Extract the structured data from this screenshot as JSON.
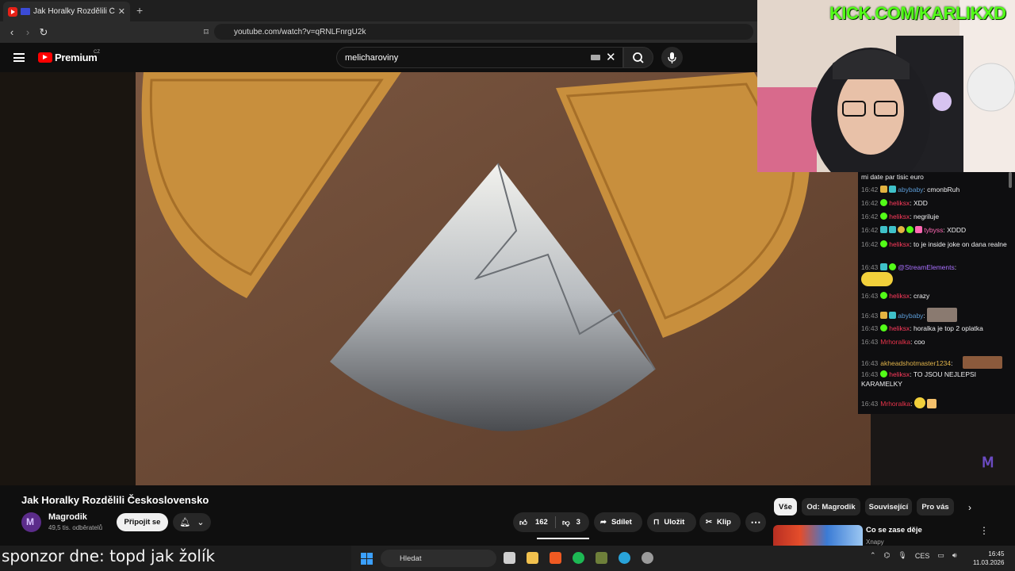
{
  "browser": {
    "tab_title": "Jak Horalky Rozdělili Českosl",
    "new_tab": "+",
    "url": "youtube.com/watch?v=qRNLFnrgU2k"
  },
  "youtube": {
    "logo_text": "Premium",
    "region": "CZ",
    "search_value": "melicharoviny"
  },
  "overlay": {
    "kick_text": "KICK.COM/KARLIKXD"
  },
  "chat": {
    "messages": [
      {
        "time": "",
        "user": "",
        "text": "mi date par tisic euro",
        "color": "#efeff1"
      },
      {
        "time": "16:42",
        "user": "abybaby",
        "text": "cmonbRuh",
        "color": "#5b9bd5"
      },
      {
        "time": "16:42",
        "user": "heliksx",
        "text": "XDD",
        "color": "#ff3b5c"
      },
      {
        "time": "16:42",
        "user": "heliksx",
        "text": "negriluje",
        "color": "#ff3b5c"
      },
      {
        "time": "16:42",
        "user": "tybyss",
        "text": "XDDD",
        "color": "#ff69b4"
      },
      {
        "time": "16:42",
        "user": "heliksx",
        "text": "to je inside joke on dana realne",
        "color": "#ff3b5c"
      },
      {
        "time": "16:43",
        "user": "@StreamElements",
        "text": "",
        "color": "#a970ff"
      },
      {
        "time": "16:43",
        "user": "heliksx",
        "text": "crazy",
        "color": "#ff3b5c"
      },
      {
        "time": "16:43",
        "user": "abybaby",
        "text": "",
        "color": "#5b9bd5"
      },
      {
        "time": "16:43",
        "user": "heliksx",
        "text": "horalka je top 2 oplatka",
        "color": "#ff3b5c"
      },
      {
        "time": "16:43",
        "user": "Mrhoralka",
        "text": "coo",
        "color": "#e8334a"
      },
      {
        "time": "16:43",
        "user": "akheadshotmaster1234",
        "text": "",
        "color": "#e0b34a"
      },
      {
        "time": "16:43",
        "user": "heliksx",
        "text": "TO JSOU NEJLEPSI KARAMELKY",
        "color": "#ff3b5c"
      },
      {
        "time": "16:43",
        "user": "Mrhoralka",
        "text": "",
        "color": "#e8334a"
      }
    ]
  },
  "video": {
    "title": "Jak Horalky Rozdělili Československo",
    "channel": "Magrodik",
    "subscribers": "49,5 tis. odběratelů",
    "join_label": "Připojit se",
    "likes": "162",
    "dislikes": "3",
    "share_label": "Sdílet",
    "save_label": "Uložit",
    "clip_label": "Klip",
    "more_label": "⋯"
  },
  "sidebar": {
    "chips": [
      "Vše",
      "Od: Magrodik",
      "Související",
      "Pro vás"
    ],
    "rec_title": "Co se zase děje",
    "rec_channel": "Xnapy"
  },
  "subtitle": "sponzor dne: topd jak žolík",
  "taskbar": {
    "search_placeholder": "Hledat",
    "lang": "CES",
    "time": "16:45",
    "date": "11.03.2026"
  },
  "colors": {
    "yt_red": "#ff0000",
    "kick_green": "#53fc18",
    "accent_purple": "#6b4bc1"
  }
}
